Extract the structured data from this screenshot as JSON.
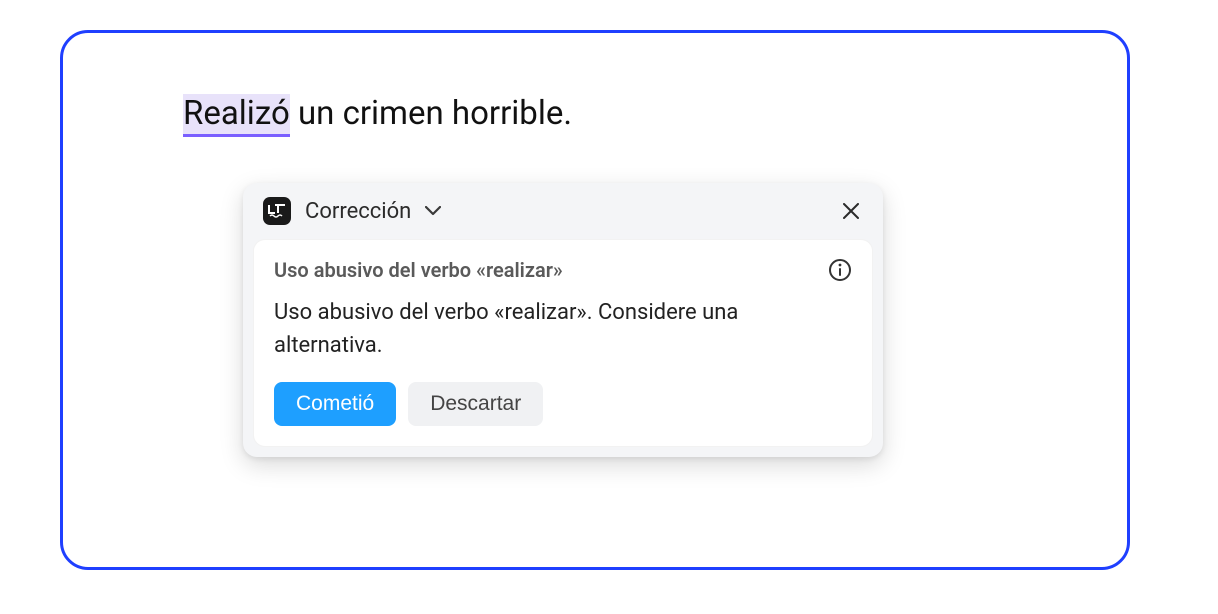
{
  "sentence": {
    "highlighted": "Realizó",
    "rest": " un crimen horrible."
  },
  "popup": {
    "title": "Corrección",
    "rule_title": "Uso abusivo del verbo «realizar»",
    "description": "Uso abusivo del verbo «realizar». Considere una alternativa.",
    "suggestion": "Cometió",
    "dismiss": "Descartar"
  }
}
